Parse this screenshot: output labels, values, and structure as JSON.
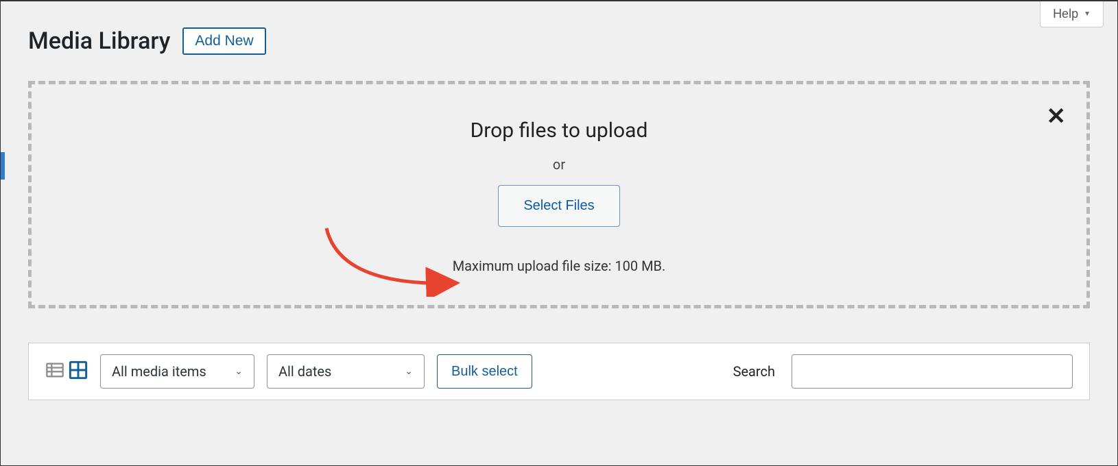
{
  "topbar": {
    "help_label": "Help"
  },
  "header": {
    "title": "Media Library",
    "add_new_label": "Add New"
  },
  "dropzone": {
    "title": "Drop files to upload",
    "or_label": "or",
    "select_files_label": "Select Files",
    "max_size_text": "Maximum upload file size: 100 MB."
  },
  "toolbar": {
    "filter_media_selected": "All media items",
    "filter_dates_selected": "All dates",
    "bulk_select_label": "Bulk select",
    "search_label": "Search",
    "search_value": ""
  }
}
